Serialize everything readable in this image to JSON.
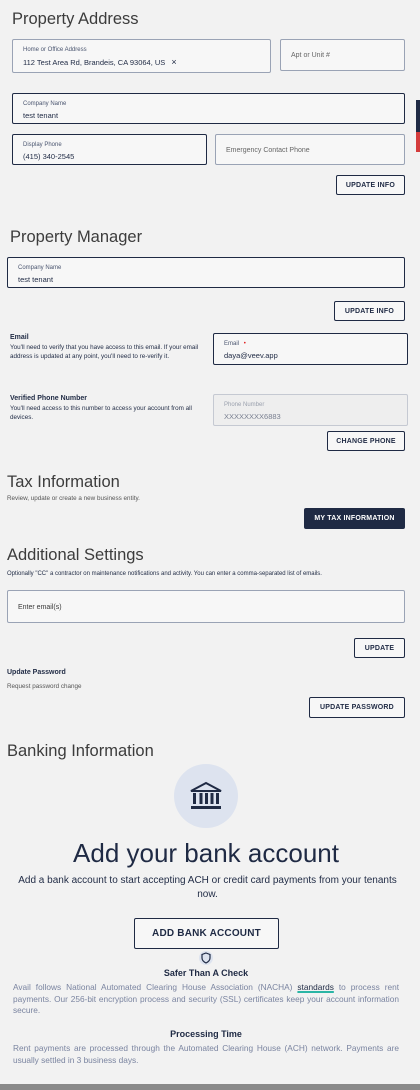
{
  "property_address": {
    "title": "Property Address",
    "home_label": "Home or Office Address",
    "home_value": "112 Test Area Rd, Brandeis, CA 93064, US",
    "apt_placeholder": "Apt or Unit #",
    "company_label": "Company Name",
    "company_value": "test tenant",
    "display_phone_label": "Display Phone",
    "display_phone_value": "(415) 340-2545",
    "emergency_placeholder": "Emergency Contact Phone",
    "update_label": "UPDATE INFO"
  },
  "property_manager": {
    "title": "Property Manager",
    "company_label": "Company Name",
    "company_value": "test tenant",
    "update_label": "UPDATE INFO",
    "email_heading": "Email",
    "email_desc": "You'll need to verify that you have access to this email. If your email address is updated at any point, you'll need to re-verify it.",
    "email_label": "Email",
    "email_required": "•",
    "email_value": "daya@veev.app",
    "phone_heading": "Verified Phone Number",
    "phone_desc": "You'll need access to this number to access your account from all devices.",
    "phone_label": "Phone Number",
    "phone_value": "XXXXXXXX6883",
    "change_phone_label": "CHANGE PHONE"
  },
  "tax": {
    "title": "Tax Information",
    "subtitle": "Review, update or create a new business entity.",
    "button_label": "MY TAX INFORMATION"
  },
  "additional": {
    "title": "Additional Settings",
    "subtitle": "Optionally \"CC\" a contractor on maintenance notifications and activity. You can enter a comma-separated list of emails.",
    "emails_placeholder": "Enter email(s)",
    "update_label": "UPDATE",
    "password_heading": "Update Password",
    "password_desc": "Request password change",
    "password_button": "UPDATE PASSWORD"
  },
  "banking": {
    "title": "Banking Information",
    "icon": "bank-icon",
    "heading": "Add your bank account",
    "subtitle": "Add a bank account to start accepting ACH or credit card payments from your tenants now.",
    "button_label": "ADD BANK ACCOUNT",
    "shield_icon": "shield-icon",
    "safer_heading": "Safer Than A Check",
    "safer_text_before": "Avail follows National Automated Clearing House Association (NACHA)",
    "safer_link": "standards",
    "safer_text_after": "to process rent payments. Our 256-bit encryption process and security (SSL) certificates keep your account information secure.",
    "processing_heading": "Processing Time",
    "processing_text": "Rent payments are processed through the Automated Clearing House (ACH) network. Payments are usually settled in 3 business days."
  },
  "colors": {
    "navy": "#1f2a44",
    "accent_red": "#e02020",
    "link_underline": "#2bb5a5",
    "bank_circle": "#dde3ef"
  }
}
